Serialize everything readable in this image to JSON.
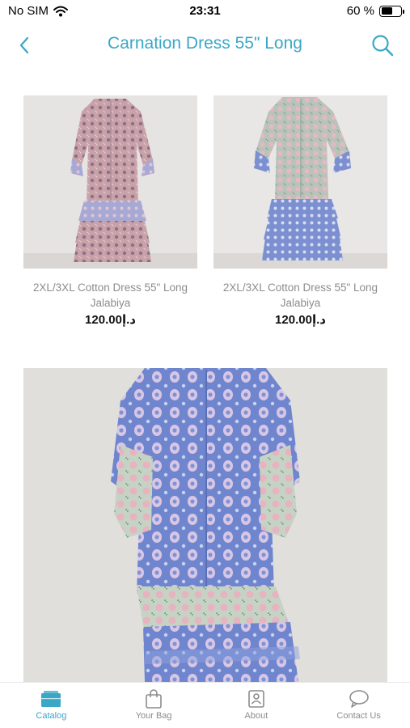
{
  "status_bar": {
    "carrier": "No SIM",
    "time": "23:31",
    "battery_percent": "60 %",
    "battery_level": 0.6
  },
  "nav": {
    "title": "Carnation Dress 55\" Long",
    "back_icon": "chevron-left-icon",
    "search_icon": "search-icon"
  },
  "products": [
    {
      "name": "2XL/3XL Cotton Dress 55\" Long Jalabiya",
      "price": "120.00د.إ"
    },
    {
      "name": "2XL/3XL Cotton Dress 55\" Long Jalabiya",
      "price": "120.00د.إ"
    }
  ],
  "tabs": [
    {
      "label": "Catalog",
      "icon": "catalog-icon",
      "active": true
    },
    {
      "label": "Your Bag",
      "icon": "bag-icon",
      "active": false
    },
    {
      "label": "About",
      "icon": "about-icon",
      "active": false
    },
    {
      "label": "Contact Us",
      "icon": "chat-icon",
      "active": false
    }
  ],
  "colors": {
    "accent": "#3aa7c6",
    "inactive": "#8c8c8c"
  }
}
